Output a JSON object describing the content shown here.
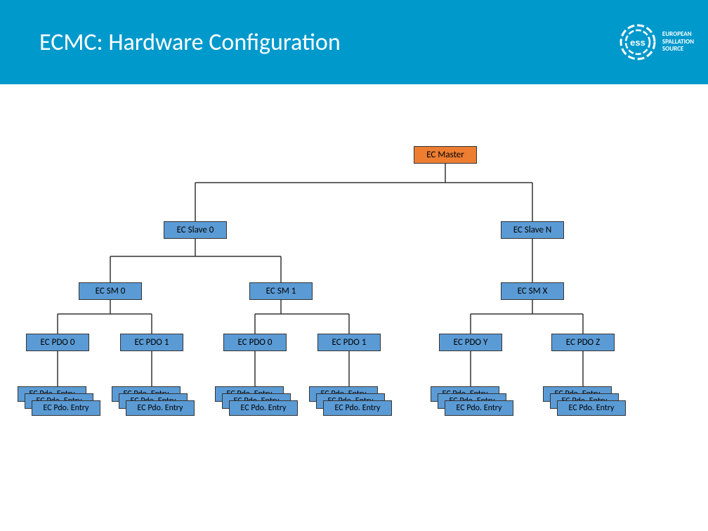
{
  "header": {
    "title": "ECMC: Hardware Configuration",
    "logo_text_line1": "EUROPEAN",
    "logo_text_line2": "SPALLATION",
    "logo_text_line3": "SOURCE",
    "logo_abbrev": "ess"
  },
  "nodes": {
    "master": "EC Master",
    "slave0": "EC Slave 0",
    "slaveN": "EC Slave N",
    "sm0": "EC SM 0",
    "sm1": "EC SM 1",
    "smX": "EC SM X",
    "pdo": [
      "EC PDO 0",
      "EC PDO 1",
      "EC PDO 0",
      "EC PDO 1",
      "EC PDO Y",
      "EC PDO Z"
    ],
    "entry": "EC Pdo. Entry"
  },
  "chart_data": {
    "type": "tree",
    "title": "ECMC: Hardware Configuration",
    "root": {
      "label": "EC Master",
      "children": [
        {
          "label": "EC Slave 0",
          "children": [
            {
              "label": "EC SM 0",
              "children": [
                {
                  "label": "EC PDO 0",
                  "children": [
                    {
                      "label": "EC Pdo. Entry",
                      "repeat": 3
                    }
                  ]
                },
                {
                  "label": "EC PDO 1",
                  "children": [
                    {
                      "label": "EC Pdo. Entry",
                      "repeat": 3
                    }
                  ]
                }
              ]
            },
            {
              "label": "EC SM 1",
              "children": [
                {
                  "label": "EC PDO 0",
                  "children": [
                    {
                      "label": "EC Pdo. Entry",
                      "repeat": 3
                    }
                  ]
                },
                {
                  "label": "EC PDO 1",
                  "children": [
                    {
                      "label": "EC Pdo. Entry",
                      "repeat": 3
                    }
                  ]
                }
              ]
            }
          ]
        },
        {
          "label": "EC Slave N",
          "children": [
            {
              "label": "EC SM X",
              "children": [
                {
                  "label": "EC PDO Y",
                  "children": [
                    {
                      "label": "EC Pdo. Entry",
                      "repeat": 3
                    }
                  ]
                },
                {
                  "label": "EC PDO Z",
                  "children": [
                    {
                      "label": "EC Pdo. Entry",
                      "repeat": 3
                    }
                  ]
                }
              ]
            }
          ]
        }
      ]
    }
  }
}
